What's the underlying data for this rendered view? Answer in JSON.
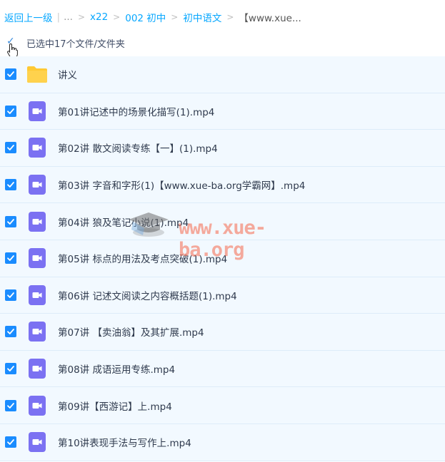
{
  "breadcrumb": {
    "back": "返回上一级",
    "ellipsis": "...",
    "items": [
      "x22",
      "002 初中",
      "初中语文",
      "【www.xue..."
    ]
  },
  "selection": {
    "label": "已选中17个文件/文件夹"
  },
  "files": [
    {
      "name": "讲义",
      "type": "folder"
    },
    {
      "name": "第01讲记述中的场景化描写(1).mp4",
      "type": "video"
    },
    {
      "name": "第02讲 散文阅读专练【一】(1).mp4",
      "type": "video"
    },
    {
      "name": "第03讲 字音和字形(1)【www.xue-ba.org学霸网】.mp4",
      "type": "video"
    },
    {
      "name": "第04讲 狼及笔记小说(1).mp4",
      "type": "video"
    },
    {
      "name": "第05讲 标点的用法及考点突破(1).mp4",
      "type": "video"
    },
    {
      "name": "第06讲 记述文阅读之内容概括题(1).mp4",
      "type": "video"
    },
    {
      "name": "第07讲 【卖油翁】及其扩展.mp4",
      "type": "video"
    },
    {
      "name": "第08讲 成语运用专练.mp4",
      "type": "video"
    },
    {
      "name": "第09讲【西游记】上.mp4",
      "type": "video"
    },
    {
      "name": "第10讲表现手法与写作上.mp4",
      "type": "video"
    }
  ],
  "watermark": {
    "text": "www.xue-ba.org"
  },
  "colors": {
    "link": "#06a7ff",
    "checkbox": "#1a8cff",
    "row_bg": "#f2f9ff",
    "video_icon": "#7b71f2",
    "folder_icon": "#ffc933"
  }
}
